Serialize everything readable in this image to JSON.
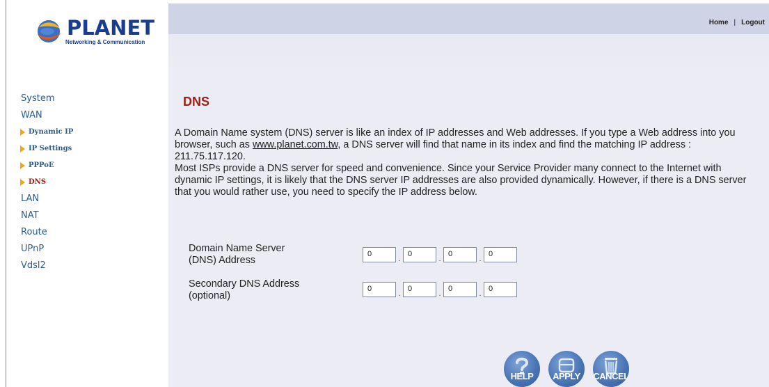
{
  "logo": {
    "name": "PLANET",
    "tagline": "Networking & Communication"
  },
  "topnav": {
    "home": "Home",
    "separator": "|",
    "logout": "Logout"
  },
  "sidebar": {
    "system": "System",
    "wan": "WAN",
    "sub": [
      "Dynamic IP",
      "IP Settings",
      "PPPoE",
      "DNS"
    ],
    "lan": "LAN",
    "nat": "NAT",
    "route": "Route",
    "upnp": "UPnP",
    "vdsl2": "Vdsl2"
  },
  "page": {
    "title": "DNS"
  },
  "description": {
    "line1a": "A Domain Name system (DNS) server is like an index of IP addresses and Web addresses. If you type a Web address into you browser, such as ",
    "link": "www.planet.com.tw",
    "line1b": ", a DNS server will find that name in its index and find the matching IP address : 211.75.117.120.",
    "line2": "Most ISPs provide a DNS server for speed and convenience. Since your Service Provider many connect to the Internet with dynamic IP settings, it is likely that the DNS server IP addresses are also provided dynamically. However, if there is a DNS server that you would rather use, you need to specify the IP address below."
  },
  "form": {
    "primary_label_1": "Domain Name Server",
    "primary_label_2": "(DNS) Address",
    "primary": [
      "0",
      "0",
      "0",
      "0"
    ],
    "secondary_label_1": "Secondary DNS Address",
    "secondary_label_2": "(optional)",
    "secondary": [
      "0",
      "0",
      "0",
      "0"
    ],
    "separator": "."
  },
  "buttons": {
    "help": "HELP",
    "apply": "APPLY",
    "cancel": "CANCEL"
  },
  "colors": {
    "accent": "#9e1f16",
    "nav": "#2b5c8f",
    "panel": "#ececf4",
    "topbar": "#cfd3e6"
  }
}
